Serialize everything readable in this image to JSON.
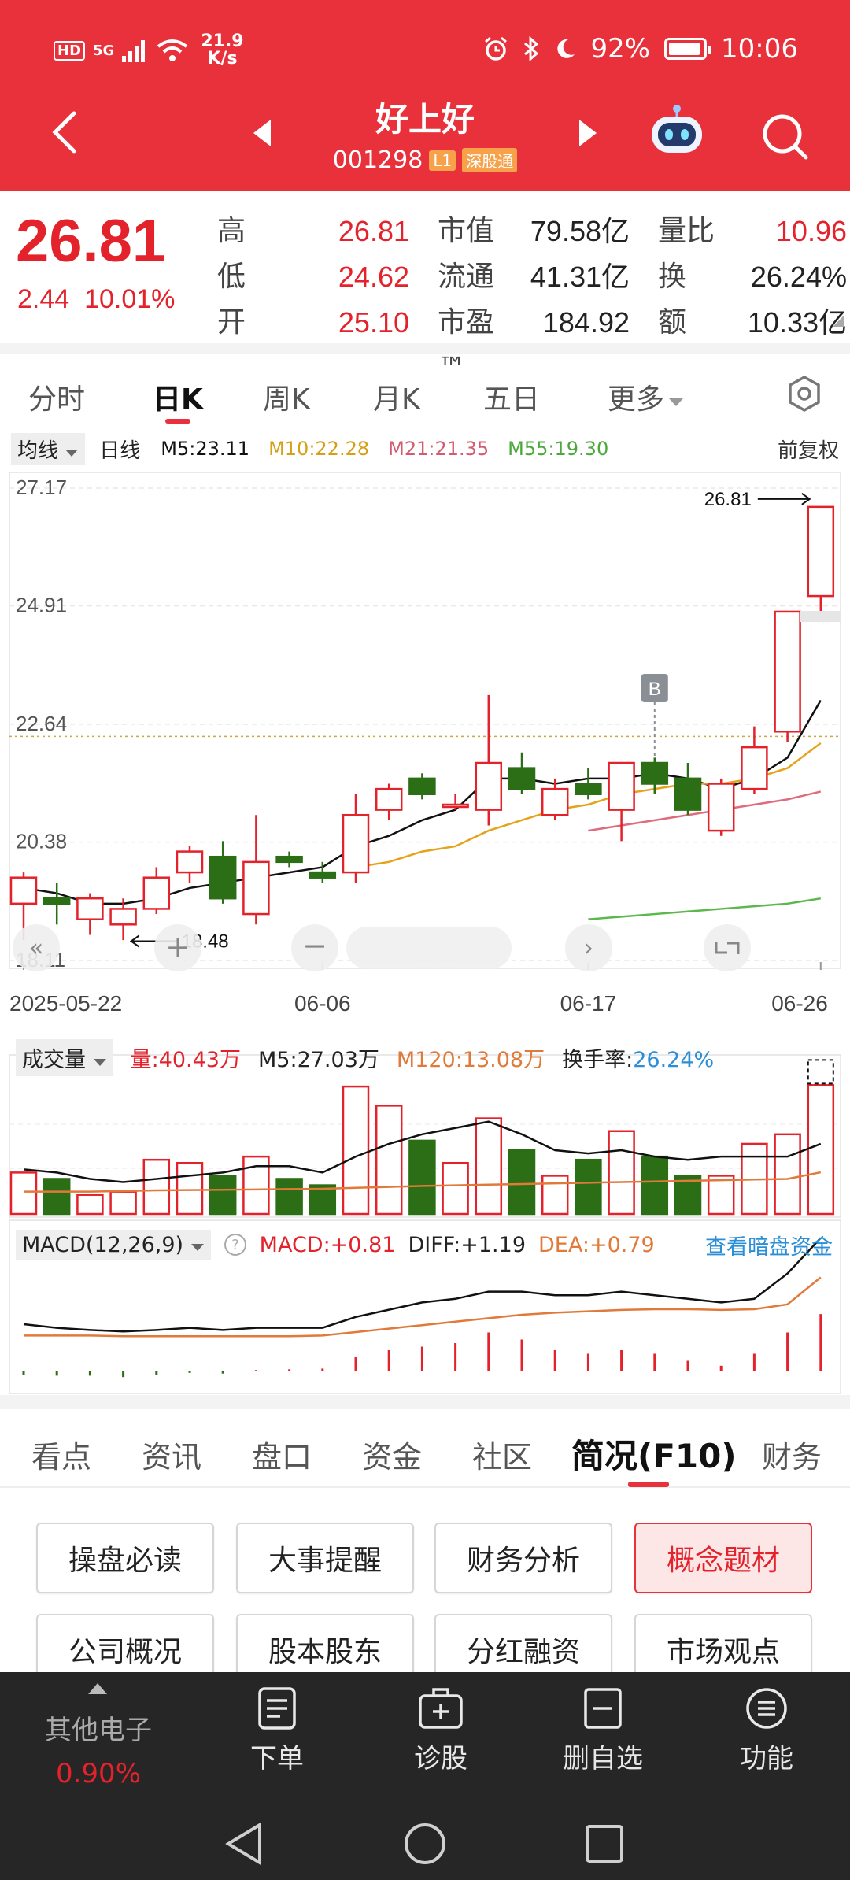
{
  "status_bar": {
    "net_type": "HD",
    "signal": "5G",
    "speed_value": "21.9",
    "speed_unit": "K/s",
    "battery": "92%",
    "battery_fraction": 0.92,
    "time": "10:06"
  },
  "header": {
    "stock_name": "好上好",
    "stock_code": "001298",
    "level_badge": "L1",
    "market_badge": "深股通"
  },
  "quote": {
    "price": "26.81",
    "change_abs": "2.44",
    "change_pct": "10.01%",
    "rows": [
      {
        "l1": "高",
        "v1": "26.81",
        "l2": "市值",
        "v2": "79.58亿",
        "l3": "量比",
        "v3": "10.96"
      },
      {
        "l1": "低",
        "v1": "24.62",
        "l2": "流通",
        "v2": "41.31亿",
        "l3": "换",
        "v3": "26.24%"
      },
      {
        "l1": "开",
        "v1": "25.10",
        "l2": "市盈™",
        "v2": "184.92",
        "l3": "额",
        "v3": "10.33亿"
      }
    ]
  },
  "chart_tabs": [
    "分时",
    "日K",
    "周K",
    "月K",
    "五日",
    "更多"
  ],
  "indicators": {
    "ma_label": "均线",
    "period": "日线",
    "m5": "M5:23.11",
    "m10": "M10:22.28",
    "m21": "M21:21.35",
    "m55": "M55:19.30",
    "adjust": "前复权"
  },
  "colors": {
    "up": "#e3222b",
    "down": "#2b6e16",
    "m5": "#111111",
    "m10": "#e5a31b",
    "m21": "#e06b7d",
    "m55": "#5bb84a"
  },
  "chart_data": {
    "type": "candlestick",
    "y_ticks": [
      "27.17",
      "24.91",
      "22.64",
      "20.38",
      "18.11"
    ],
    "ylim": [
      18.11,
      27.17
    ],
    "x_ticks": [
      "2025-05-22",
      "06-06",
      "06-17",
      "06-26"
    ],
    "high_label": "26.81",
    "low_label": "18.48",
    "b_marker": "B",
    "candles": [
      {
        "o": 19.2,
        "h": 19.8,
        "l": 18.5,
        "c": 19.7
      },
      {
        "o": 19.3,
        "h": 19.6,
        "l": 18.8,
        "c": 19.2
      },
      {
        "o": 18.9,
        "h": 19.4,
        "l": 18.6,
        "c": 19.3
      },
      {
        "o": 18.8,
        "h": 19.3,
        "l": 18.5,
        "c": 19.1
      },
      {
        "o": 19.1,
        "h": 19.9,
        "l": 19.0,
        "c": 19.7
      },
      {
        "o": 19.8,
        "h": 20.3,
        "l": 19.6,
        "c": 20.2
      },
      {
        "o": 20.1,
        "h": 20.4,
        "l": 19.2,
        "c": 19.3
      },
      {
        "o": 19.0,
        "h": 20.9,
        "l": 18.8,
        "c": 20.0
      },
      {
        "o": 20.1,
        "h": 20.2,
        "l": 19.9,
        "c": 20.0
      },
      {
        "o": 19.8,
        "h": 20.0,
        "l": 19.6,
        "c": 19.7
      },
      {
        "o": 19.8,
        "h": 21.3,
        "l": 19.6,
        "c": 20.9
      },
      {
        "o": 21.0,
        "h": 21.5,
        "l": 20.8,
        "c": 21.4
      },
      {
        "o": 21.6,
        "h": 21.7,
        "l": 21.2,
        "c": 21.3
      },
      {
        "o": 21.1,
        "h": 21.3,
        "l": 21.0,
        "c": 21.1
      },
      {
        "o": 21.0,
        "h": 23.2,
        "l": 20.7,
        "c": 21.9
      },
      {
        "o": 21.8,
        "h": 22.1,
        "l": 21.3,
        "c": 21.4
      },
      {
        "o": 20.9,
        "h": 21.6,
        "l": 20.8,
        "c": 21.4
      },
      {
        "o": 21.5,
        "h": 21.8,
        "l": 21.2,
        "c": 21.3
      },
      {
        "o": 21.0,
        "h": 21.9,
        "l": 20.4,
        "c": 21.9
      },
      {
        "o": 21.9,
        "h": 22.0,
        "l": 21.3,
        "c": 21.5
      },
      {
        "o": 21.6,
        "h": 21.9,
        "l": 20.9,
        "c": 21.0
      },
      {
        "o": 20.6,
        "h": 21.6,
        "l": 20.5,
        "c": 21.5
      },
      {
        "o": 21.4,
        "h": 22.6,
        "l": 21.3,
        "c": 22.2
      },
      {
        "o": 22.5,
        "h": 24.8,
        "l": 22.3,
        "c": 24.8
      },
      {
        "o": 25.1,
        "h": 26.81,
        "l": 24.62,
        "c": 26.81
      }
    ],
    "ma5": [
      19.5,
      19.4,
      19.2,
      19.2,
      19.3,
      19.5,
      19.6,
      19.7,
      19.8,
      19.9,
      20.3,
      20.5,
      20.8,
      21.0,
      21.6,
      21.6,
      21.5,
      21.6,
      21.6,
      21.7,
      21.6,
      21.4,
      21.6,
      22.0,
      23.1
    ],
    "ma10": [
      null,
      null,
      null,
      null,
      null,
      null,
      null,
      null,
      null,
      null,
      19.9,
      20.0,
      20.2,
      20.3,
      20.6,
      20.8,
      21.0,
      21.1,
      21.3,
      21.4,
      21.5,
      21.5,
      21.6,
      21.8,
      22.28
    ],
    "ma21": [
      null,
      null,
      null,
      null,
      null,
      null,
      null,
      null,
      null,
      null,
      null,
      null,
      null,
      null,
      null,
      null,
      null,
      20.6,
      20.7,
      20.8,
      20.9,
      21.0,
      21.1,
      21.2,
      21.35
    ],
    "ma55": [
      null,
      null,
      null,
      null,
      null,
      null,
      null,
      null,
      null,
      null,
      null,
      null,
      null,
      null,
      null,
      null,
      null,
      18.9,
      18.95,
      19.0,
      19.05,
      19.1,
      19.15,
      19.2,
      19.3
    ],
    "volume": [
      13,
      11,
      6,
      7,
      17,
      16,
      12,
      18,
      11,
      9,
      40,
      34,
      23,
      16,
      30,
      20,
      12,
      17,
      26,
      18,
      12,
      12,
      22,
      25,
      40.43
    ],
    "vol_ma5": [
      14,
      13,
      11,
      10,
      11,
      12,
      13,
      15,
      15,
      13,
      18,
      22,
      25,
      27,
      29,
      25,
      20,
      19,
      20,
      18,
      17,
      18,
      18,
      18,
      22
    ],
    "vol_ma120": [
      7,
      7,
      7,
      7.2,
      7.4,
      7.5,
      7.6,
      7.7,
      7.8,
      7.9,
      8.2,
      8.5,
      8.8,
      9.0,
      9.2,
      9.4,
      9.6,
      9.8,
      10,
      10.2,
      10.4,
      10.6,
      10.8,
      11,
      13.08
    ],
    "macd_hist": [
      -0.05,
      -0.06,
      -0.06,
      -0.08,
      -0.05,
      -0.02,
      -0.03,
      0.02,
      0.03,
      0.04,
      0.2,
      0.3,
      0.35,
      0.4,
      0.55,
      0.45,
      0.3,
      0.25,
      0.3,
      0.25,
      0.15,
      0.08,
      0.25,
      0.55,
      0.81
    ],
    "diff": [
      0.0,
      -0.05,
      -0.08,
      -0.1,
      -0.08,
      -0.05,
      -0.08,
      -0.05,
      -0.05,
      -0.05,
      0.1,
      0.2,
      0.3,
      0.35,
      0.45,
      0.45,
      0.4,
      0.4,
      0.45,
      0.4,
      0.35,
      0.3,
      0.35,
      0.7,
      1.19
    ],
    "dea": [
      -0.05,
      -0.05,
      -0.05,
      -0.06,
      -0.06,
      -0.06,
      -0.06,
      -0.06,
      -0.06,
      -0.05,
      0.0,
      0.05,
      0.1,
      0.15,
      0.2,
      0.25,
      0.28,
      0.3,
      0.32,
      0.33,
      0.33,
      0.32,
      0.33,
      0.4,
      0.79
    ]
  },
  "volume_panel": {
    "label": "成交量",
    "vol": "量:40.43万",
    "m5": "M5:27.03万",
    "m120": "M120:13.08万",
    "turnover_label": "换手率:",
    "turnover_value": "26.24%"
  },
  "macd_panel": {
    "label": "MACD(12,26,9)",
    "macd": "MACD:+0.81",
    "diff": "DIFF:+1.19",
    "dea": "DEA:+0.79",
    "link": "查看暗盘资金"
  },
  "section_tabs": [
    "看点",
    "资讯",
    "盘口",
    "资金",
    "社区",
    "简况(F10)",
    "财务"
  ],
  "f10_buttons": [
    "操盘必读",
    "大事提醒",
    "财务分析",
    "概念题材",
    "公司概况",
    "股本股东",
    "分红融资",
    "市场观点"
  ],
  "bottom_bar": {
    "sector_name": "其他电子",
    "sector_pct": "0.90%",
    "items": [
      "下单",
      "诊股",
      "删自选",
      "功能"
    ]
  }
}
